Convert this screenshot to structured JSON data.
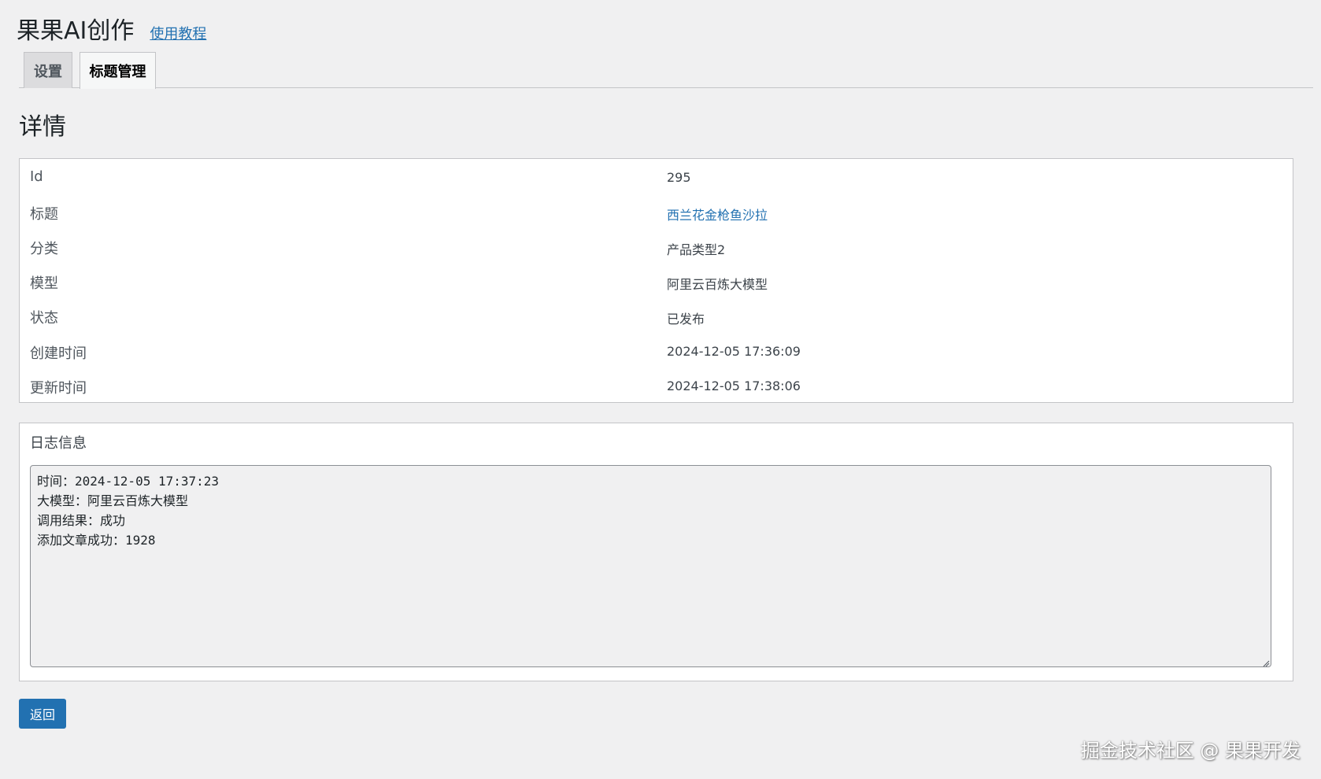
{
  "header": {
    "title": "果果AI创作",
    "help_link": "使用教程"
  },
  "tabs": [
    {
      "label": "设置",
      "active": false
    },
    {
      "label": "标题管理",
      "active": true
    }
  ],
  "section_title": "详情",
  "details": {
    "id": {
      "label": "Id",
      "value": "295"
    },
    "title": {
      "label": "标题",
      "value": "西兰花金枪鱼沙拉"
    },
    "category": {
      "label": "分类",
      "value": "产品类型2"
    },
    "model": {
      "label": "模型",
      "value": "阿里云百炼大模型"
    },
    "status": {
      "label": "状态",
      "value": "已发布"
    },
    "created": {
      "label": "创建时间",
      "value": "2024-12-05 17:36:09"
    },
    "updated": {
      "label": "更新时间",
      "value": "2024-12-05 17:38:06"
    }
  },
  "log": {
    "title": "日志信息",
    "content": "时间：2024-12-05 17:37:23\n大模型：阿里云百炼大模型\n调用结果：成功\n添加文章成功：1928"
  },
  "back_button": "返回",
  "watermark": "掘金技术社区 @ 果果开发",
  "colors": {
    "accent": "#2271b1",
    "background": "#f0f0f1",
    "border": "#c3c4c7"
  }
}
